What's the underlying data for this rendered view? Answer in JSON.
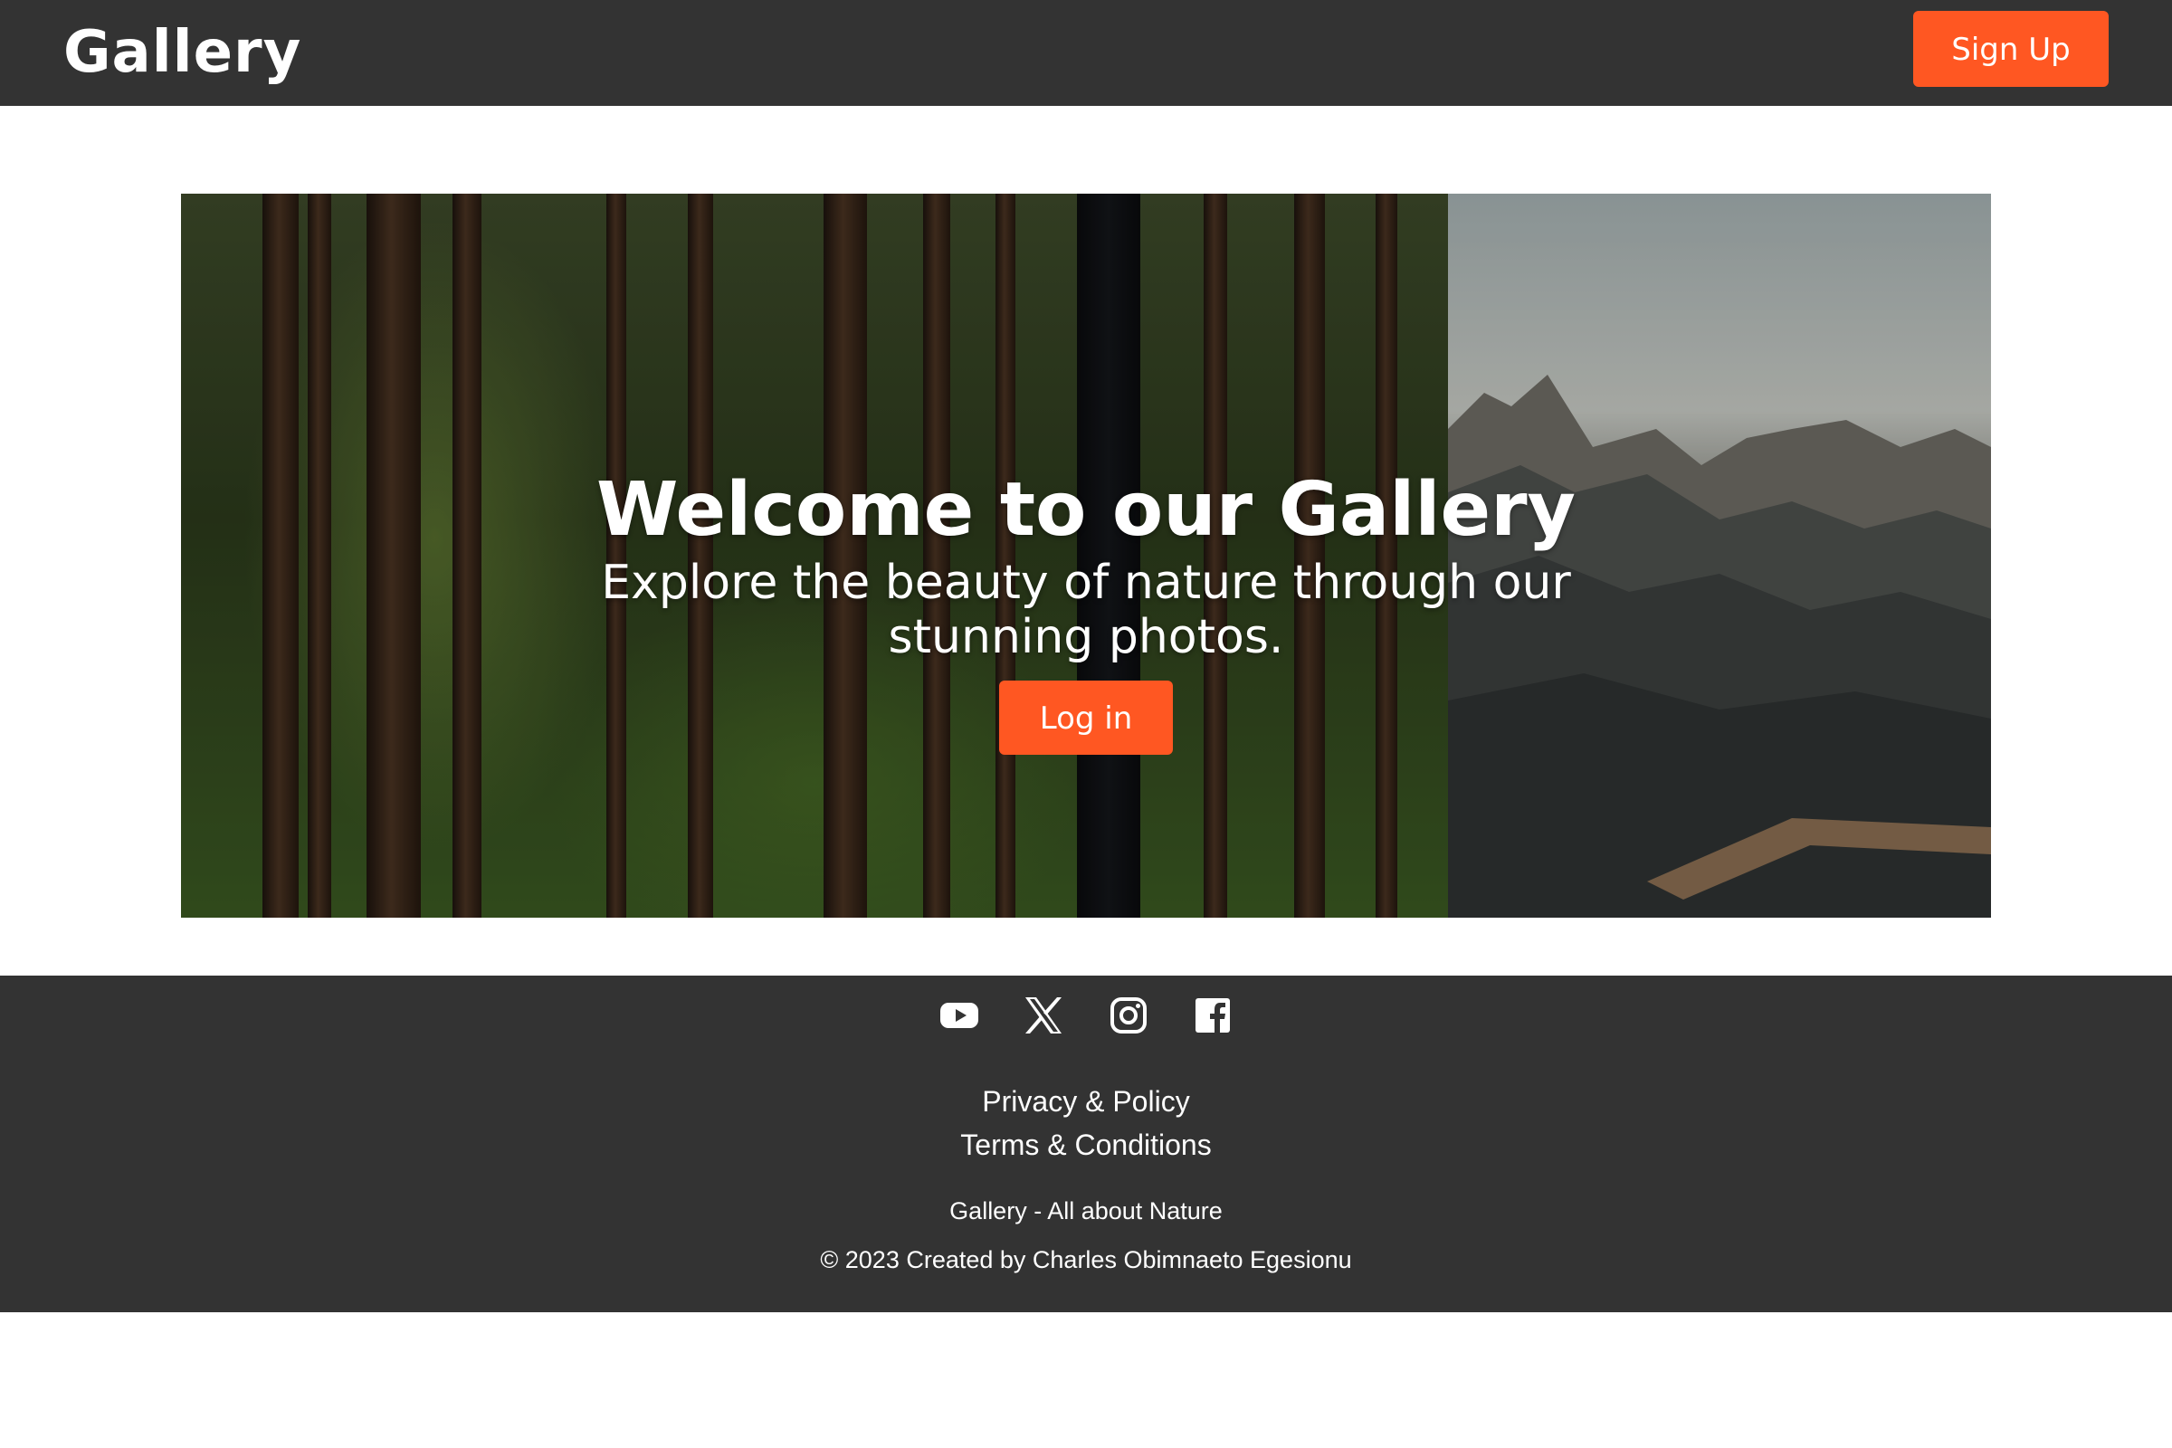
{
  "header": {
    "logo": "Gallery",
    "signup_label": "Sign Up"
  },
  "hero": {
    "title": "Welcome to our Gallery",
    "subtitle": "Explore the beauty of nature through our stunning photos.",
    "login_label": "Log in"
  },
  "footer": {
    "social": [
      {
        "name": "youtube-icon"
      },
      {
        "name": "x-icon"
      },
      {
        "name": "instagram-icon"
      },
      {
        "name": "facebook-icon"
      }
    ],
    "links": [
      {
        "label": "Privacy & Policy"
      },
      {
        "label": "Terms & Conditions"
      }
    ],
    "tagline": "Gallery - All about Nature",
    "copyright": "© 2023 Created by Charles Obimnaeto Egesionu"
  },
  "colors": {
    "header_bg": "#333333",
    "accent": "#ff5722",
    "footer_bg": "#333333"
  }
}
